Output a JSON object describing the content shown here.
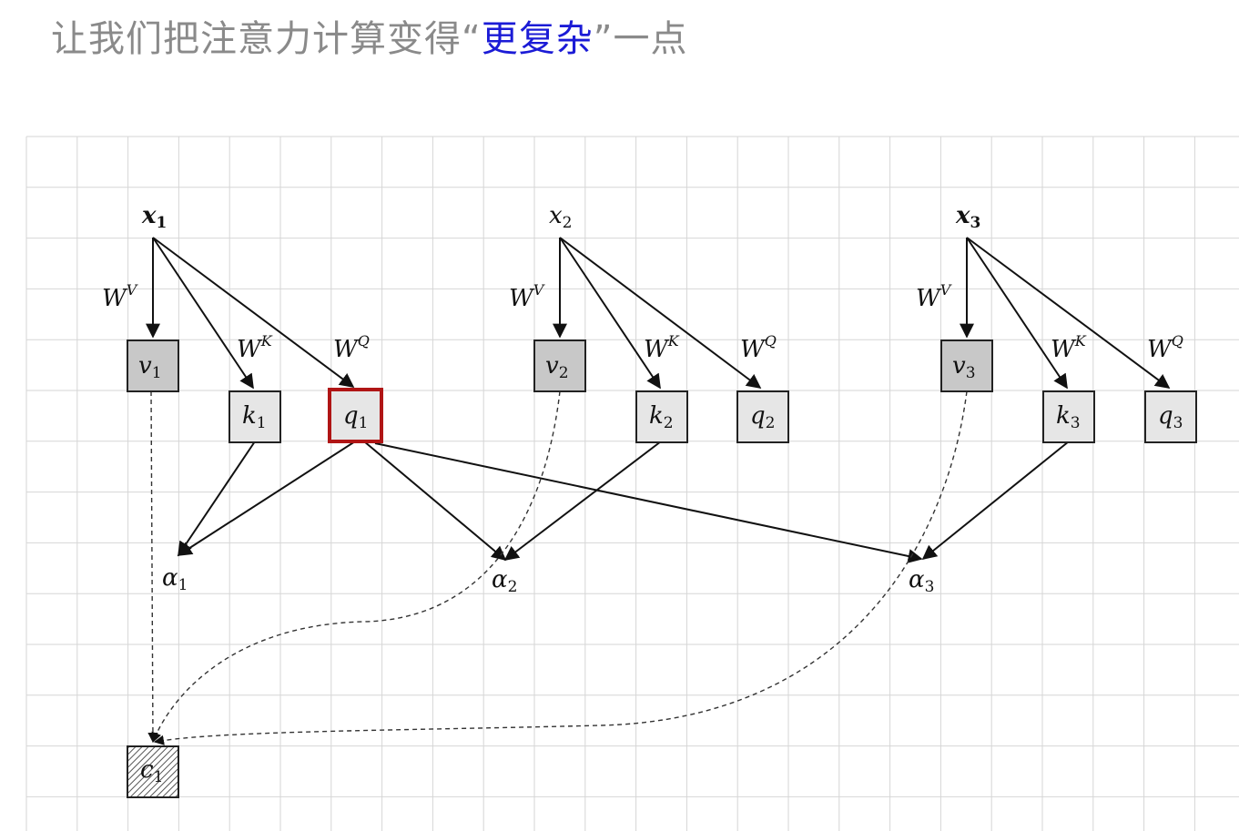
{
  "title": {
    "prefix": "让我们把注意力计算变得“",
    "highlight": "更复杂",
    "suffix": "”一点",
    "highlight_color": "#1b1bd6"
  },
  "diagram": {
    "inputs": [
      {
        "id": "x1",
        "base": "x",
        "sub": "1"
      },
      {
        "id": "x2",
        "base": "x",
        "sub": "2"
      },
      {
        "id": "x3",
        "base": "x",
        "sub": "3"
      }
    ],
    "weights": {
      "v": "V",
      "k": "K",
      "q": "Q",
      "base": "W"
    },
    "values": [
      {
        "base": "v",
        "sub": "1"
      },
      {
        "base": "v",
        "sub": "2"
      },
      {
        "base": "v",
        "sub": "3"
      }
    ],
    "keys": [
      {
        "base": "k",
        "sub": "1"
      },
      {
        "base": "k",
        "sub": "2"
      },
      {
        "base": "k",
        "sub": "3"
      }
    ],
    "queries": [
      {
        "base": "q",
        "sub": "1",
        "highlighted": true
      },
      {
        "base": "q",
        "sub": "2",
        "highlighted": false
      },
      {
        "base": "q",
        "sub": "3",
        "highlighted": false
      }
    ],
    "alphas": [
      {
        "base": "α",
        "sub": "1"
      },
      {
        "base": "α",
        "sub": "2"
      },
      {
        "base": "α",
        "sub": "3"
      }
    ],
    "context": {
      "base": "c",
      "sub": "1"
    },
    "colors": {
      "value_fill": "#c8c8c8",
      "kq_fill": "#e6e6e6",
      "highlight_border": "#b01515",
      "grid": "#d6d6d6"
    }
  }
}
